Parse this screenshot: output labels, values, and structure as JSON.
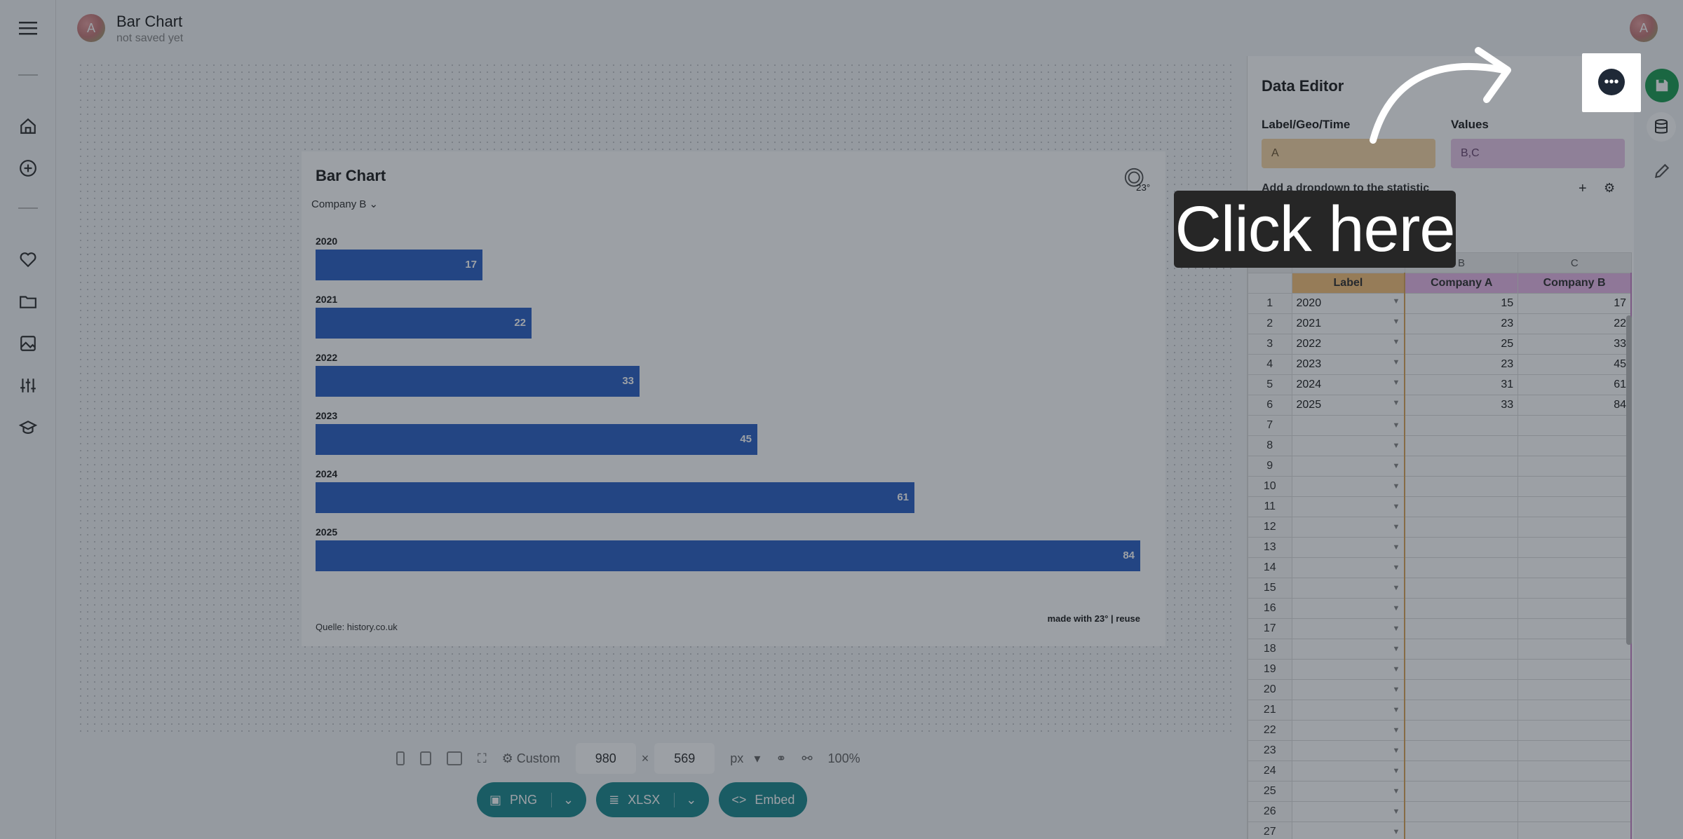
{
  "app": {
    "doc_title": "Bar Chart",
    "doc_status": "not saved yet",
    "user_initial": "A"
  },
  "chart": {
    "title": "Bar Chart",
    "dropdown_label": "Company B",
    "source": "Quelle: history.co.uk",
    "credit": "made with 23° | reuse"
  },
  "chart_data": {
    "type": "bar",
    "orientation": "horizontal",
    "categories": [
      "2020",
      "2021",
      "2022",
      "2023",
      "2024",
      "2025"
    ],
    "values": [
      17,
      22,
      33,
      45,
      61,
      84
    ],
    "title": "Bar Chart",
    "xlim": [
      0,
      84
    ],
    "bar_color": "#2f63c4"
  },
  "toolbar": {
    "size_preset": "Custom",
    "width": "980",
    "times": "×",
    "height": "569",
    "unit": "px",
    "zoom": "100%",
    "png_label": "PNG",
    "xlsx_label": "XLSX",
    "embed_label": "Embed"
  },
  "editor": {
    "title": "Data Editor",
    "label_heading": "Label/Geo/Time",
    "label_value": "A",
    "values_heading": "Values",
    "values_value": "B,C",
    "dropdown_text": "Add a dropdown to the statistic",
    "col_letters": [
      "A",
      "B",
      "C"
    ],
    "headers": [
      "Label",
      "Company A",
      "Company B"
    ],
    "rows": [
      {
        "n": "1",
        "label": "2020",
        "a": "15",
        "b": "17"
      },
      {
        "n": "2",
        "label": "2021",
        "a": "23",
        "b": "22"
      },
      {
        "n": "3",
        "label": "2022",
        "a": "25",
        "b": "33"
      },
      {
        "n": "4",
        "label": "2023",
        "a": "23",
        "b": "45"
      },
      {
        "n": "5",
        "label": "2024",
        "a": "31",
        "b": "61"
      },
      {
        "n": "6",
        "label": "2025",
        "a": "33",
        "b": "84"
      },
      {
        "n": "7",
        "label": "",
        "a": "",
        "b": ""
      },
      {
        "n": "8",
        "label": "",
        "a": "",
        "b": ""
      },
      {
        "n": "9",
        "label": "",
        "a": "",
        "b": ""
      },
      {
        "n": "10",
        "label": "",
        "a": "",
        "b": ""
      },
      {
        "n": "11",
        "label": "",
        "a": "",
        "b": ""
      },
      {
        "n": "12",
        "label": "",
        "a": "",
        "b": ""
      },
      {
        "n": "13",
        "label": "",
        "a": "",
        "b": ""
      },
      {
        "n": "14",
        "label": "",
        "a": "",
        "b": ""
      },
      {
        "n": "15",
        "label": "",
        "a": "",
        "b": ""
      },
      {
        "n": "16",
        "label": "",
        "a": "",
        "b": ""
      },
      {
        "n": "17",
        "label": "",
        "a": "",
        "b": ""
      },
      {
        "n": "18",
        "label": "",
        "a": "",
        "b": ""
      },
      {
        "n": "19",
        "label": "",
        "a": "",
        "b": ""
      },
      {
        "n": "20",
        "label": "",
        "a": "",
        "b": ""
      },
      {
        "n": "21",
        "label": "",
        "a": "",
        "b": ""
      },
      {
        "n": "22",
        "label": "",
        "a": "",
        "b": ""
      },
      {
        "n": "23",
        "label": "",
        "a": "",
        "b": ""
      },
      {
        "n": "24",
        "label": "",
        "a": "",
        "b": ""
      },
      {
        "n": "25",
        "label": "",
        "a": "",
        "b": ""
      },
      {
        "n": "26",
        "label": "",
        "a": "",
        "b": ""
      },
      {
        "n": "27",
        "label": "",
        "a": "",
        "b": ""
      }
    ]
  },
  "tutorial": {
    "callout": "Click here"
  },
  "icons": {
    "menu": "hamburger-icon",
    "home": "home-icon",
    "add": "plus-circle-icon",
    "favorites": "heart-icon",
    "folder": "folder-icon",
    "image": "image-icon",
    "settings": "sliders-icon",
    "learn": "graduation-cap-icon",
    "more": "more-horizontal-icon",
    "save": "save-icon",
    "data": "database-icon",
    "edit": "pencil-icon"
  }
}
